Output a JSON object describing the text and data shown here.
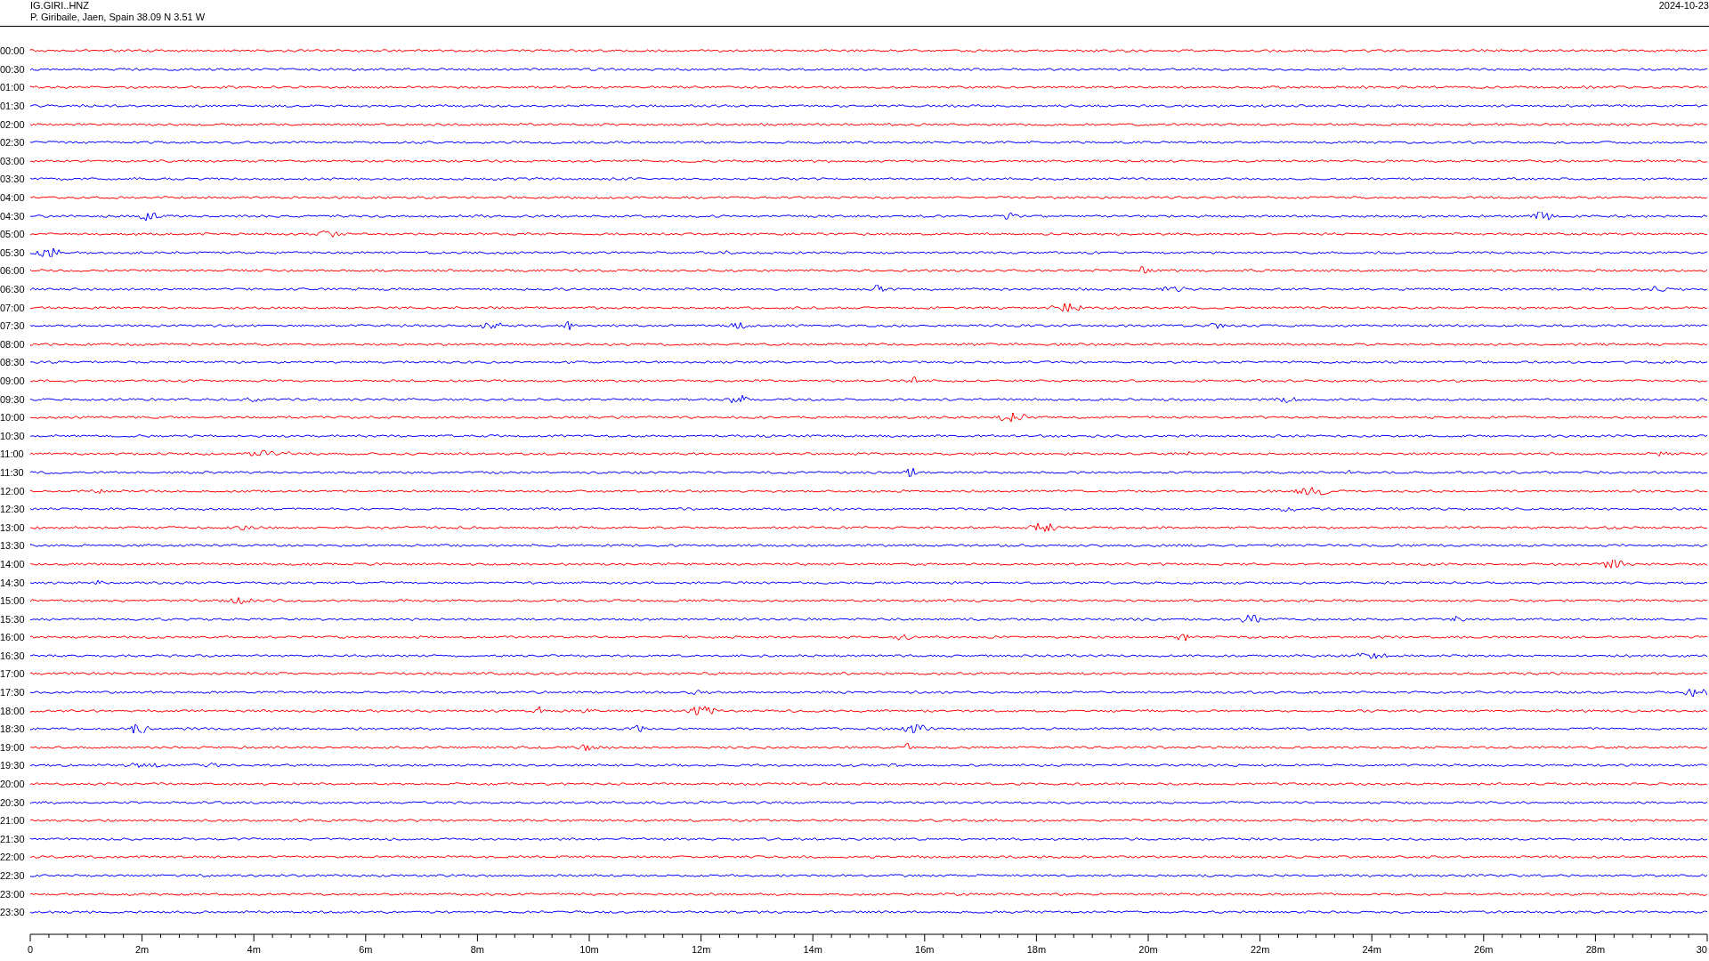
{
  "header": {
    "station": "IG.GIRI..HNZ",
    "location": "P. Giribaile, Jaen, Spain  38.09 N 3.51 W",
    "date": "2024-10-23"
  },
  "rows": [
    {
      "label": "00:00",
      "color": "#ff0000"
    },
    {
      "label": "00:30",
      "color": "#0000ff"
    },
    {
      "label": "01:00",
      "color": "#ff0000"
    },
    {
      "label": "01:30",
      "color": "#0000ff"
    },
    {
      "label": "02:00",
      "color": "#ff0000"
    },
    {
      "label": "02:30",
      "color": "#0000ff"
    },
    {
      "label": "03:00",
      "color": "#ff0000"
    },
    {
      "label": "03:30",
      "color": "#0000ff"
    },
    {
      "label": "04:00",
      "color": "#ff0000"
    },
    {
      "label": "04:30",
      "color": "#0000ff"
    },
    {
      "label": "05:00",
      "color": "#ff0000"
    },
    {
      "label": "05:30",
      "color": "#0000ff"
    },
    {
      "label": "06:00",
      "color": "#ff0000"
    },
    {
      "label": "06:30",
      "color": "#0000ff"
    },
    {
      "label": "07:00",
      "color": "#ff0000"
    },
    {
      "label": "07:30",
      "color": "#0000ff"
    },
    {
      "label": "08:00",
      "color": "#ff0000"
    },
    {
      "label": "08:30",
      "color": "#0000ff"
    },
    {
      "label": "09:00",
      "color": "#ff0000"
    },
    {
      "label": "09:30",
      "color": "#0000ff"
    },
    {
      "label": "10:00",
      "color": "#ff0000"
    },
    {
      "label": "10:30",
      "color": "#0000ff"
    },
    {
      "label": "11:00",
      "color": "#ff0000"
    },
    {
      "label": "11:30",
      "color": "#0000ff"
    },
    {
      "label": "12:00",
      "color": "#ff0000"
    },
    {
      "label": "12:30",
      "color": "#0000ff"
    },
    {
      "label": "13:00",
      "color": "#ff0000"
    },
    {
      "label": "13:30",
      "color": "#0000ff"
    },
    {
      "label": "14:00",
      "color": "#ff0000"
    },
    {
      "label": "14:30",
      "color": "#0000ff"
    },
    {
      "label": "15:00",
      "color": "#ff0000"
    },
    {
      "label": "15:30",
      "color": "#0000ff"
    },
    {
      "label": "16:00",
      "color": "#ff0000"
    },
    {
      "label": "16:30",
      "color": "#0000ff"
    },
    {
      "label": "17:00",
      "color": "#ff0000"
    },
    {
      "label": "17:30",
      "color": "#0000ff"
    },
    {
      "label": "18:00",
      "color": "#ff0000"
    },
    {
      "label": "18:30",
      "color": "#0000ff"
    },
    {
      "label": "19:00",
      "color": "#ff0000"
    },
    {
      "label": "19:30",
      "color": "#0000ff"
    },
    {
      "label": "20:00",
      "color": "#ff0000"
    },
    {
      "label": "20:30",
      "color": "#0000ff"
    },
    {
      "label": "21:00",
      "color": "#ff0000"
    },
    {
      "label": "21:30",
      "color": "#0000ff"
    },
    {
      "label": "22:00",
      "color": "#ff0000"
    },
    {
      "label": "22:30",
      "color": "#0000ff"
    },
    {
      "label": "23:00",
      "color": "#ff0000"
    },
    {
      "label": "23:30",
      "color": "#0000ff"
    }
  ],
  "x_axis": {
    "labels": [
      "0",
      "2m",
      "4m",
      "6m",
      "8m",
      "10m",
      "12m",
      "14m",
      "16m",
      "18m",
      "20m",
      "22m",
      "24m",
      "26m",
      "28m",
      "30"
    ]
  }
}
